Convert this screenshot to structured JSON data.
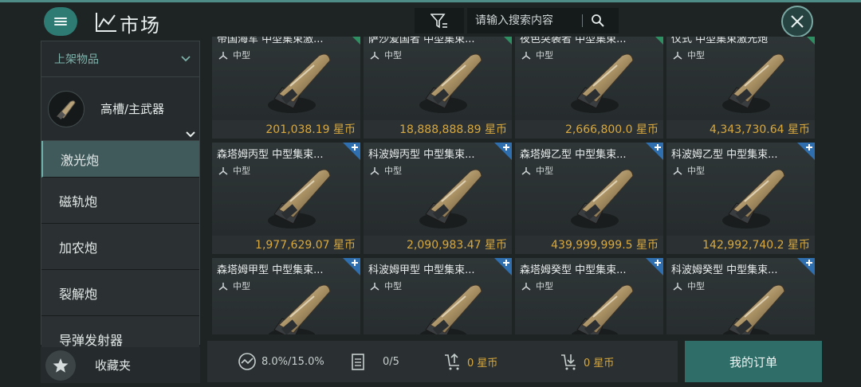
{
  "header": {
    "title": "市场",
    "search_placeholder": "请输入搜索内容"
  },
  "sidebar": {
    "dropdown_label": "上架物品",
    "category_label": "高槽/主武器",
    "items": [
      {
        "label": "激光炮",
        "active": true
      },
      {
        "label": "磁轨炮",
        "active": false
      },
      {
        "label": "加农炮",
        "active": false
      },
      {
        "label": "裂解炮",
        "active": false
      },
      {
        "label": "导弹发射器",
        "active": false
      }
    ],
    "favorites_label": "收藏夹"
  },
  "grid": {
    "rows": [
      [
        {
          "name": "帝国海军 中型集束激...",
          "tier": "中型",
          "price": "201,038.19 星币",
          "badge": "check"
        },
        {
          "name": "萨沙爱国者 中型集束...",
          "tier": "中型",
          "price": "18,888,888.89 星币",
          "badge": "check"
        },
        {
          "name": "夜色突袭者 中型集束...",
          "tier": "中型",
          "price": "2,666,800.0 星币",
          "badge": "check"
        },
        {
          "name": "仪式 中型集束激光炮",
          "tier": "中型",
          "price": "4,343,730.64 星币",
          "badge": "check"
        }
      ],
      [
        {
          "name": "森塔姆丙型 中型集束...",
          "tier": "中型",
          "price": "1,977,629.07 星币",
          "badge": "plus"
        },
        {
          "name": "科波姆丙型 中型集束...",
          "tier": "中型",
          "price": "2,090,983.47 星币",
          "badge": "plus"
        },
        {
          "name": "森塔姆乙型 中型集束...",
          "tier": "中型",
          "price": "439,999,999.5 星币",
          "badge": "plus"
        },
        {
          "name": "科波姆乙型 中型集束...",
          "tier": "中型",
          "price": "142,992,740.2 星币",
          "badge": "plus"
        }
      ],
      [
        {
          "name": "森塔姆甲型 中型集束...",
          "tier": "中型",
          "price": "",
          "badge": "plus"
        },
        {
          "name": "科波姆甲型 中型集束...",
          "tier": "中型",
          "price": "",
          "badge": "plus"
        },
        {
          "name": "森塔姆癸型 中型集束...",
          "tier": "中型",
          "price": "",
          "badge": "plus"
        },
        {
          "name": "科波姆癸型 中型集束...",
          "tier": "中型",
          "price": "",
          "badge": "plus"
        }
      ]
    ]
  },
  "bottom": {
    "tax": "8.0%/15.0%",
    "orders_count": "0/5",
    "sell_value": "0 星币",
    "buy_value": "0 星币",
    "my_orders_label": "我的订单"
  },
  "colors": {
    "accent": "#2f6e68",
    "price_gold": "#d8a83e",
    "badge_green": "#2e8f63",
    "badge_blue": "#2f6fb0"
  },
  "icons": [
    "menu-icon",
    "chart-icon",
    "filter-icon",
    "search-icon",
    "close-icon",
    "chevron-down-icon",
    "weapon-icon",
    "star-icon",
    "tier-icon",
    "check-badge-icon",
    "plus-badge-icon",
    "tax-icon",
    "clipboard-icon",
    "sell-icon",
    "buy-icon"
  ]
}
